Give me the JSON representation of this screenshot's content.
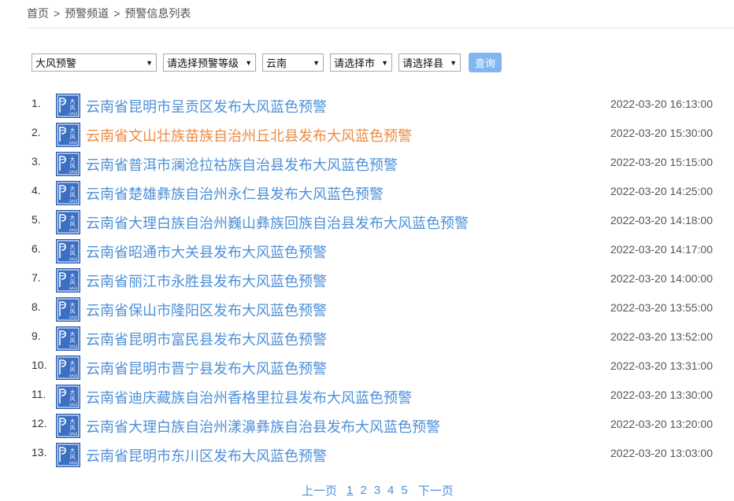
{
  "breadcrumb": {
    "home": "首页",
    "channel": "预警频道",
    "current": "预警信息列表",
    "separator": ">"
  },
  "filters": {
    "type": "大风预警",
    "level": "请选择预警等级",
    "province": "云南",
    "city": "请选择市",
    "county": "请选择县",
    "query_label": "查询"
  },
  "icon": {
    "name": "gale-blue-warning-icon",
    "text_top": "大风",
    "text_bottom": "GALE",
    "color": "#3a6fc4"
  },
  "alerts": [
    {
      "num": "1.",
      "title": "云南省昆明市呈贡区发布大风蓝色预警",
      "time": "2022-03-20 16:13:00"
    },
    {
      "num": "2.",
      "title": "云南省文山壮族苗族自治州丘北县发布大风蓝色预警",
      "time": "2022-03-20 15:30:00"
    },
    {
      "num": "3.",
      "title": "云南省普洱市澜沧拉祜族自治县发布大风蓝色预警",
      "time": "2022-03-20 15:15:00"
    },
    {
      "num": "4.",
      "title": "云南省楚雄彝族自治州永仁县发布大风蓝色预警",
      "time": "2022-03-20 14:25:00"
    },
    {
      "num": "5.",
      "title": "云南省大理白族自治州巍山彝族回族自治县发布大风蓝色预警",
      "time": "2022-03-20 14:18:00"
    },
    {
      "num": "6.",
      "title": "云南省昭通市大关县发布大风蓝色预警",
      "time": "2022-03-20 14:17:00"
    },
    {
      "num": "7.",
      "title": "云南省丽江市永胜县发布大风蓝色预警",
      "time": "2022-03-20 14:00:00"
    },
    {
      "num": "8.",
      "title": "云南省保山市隆阳区发布大风蓝色预警",
      "time": "2022-03-20 13:55:00"
    },
    {
      "num": "9.",
      "title": "云南省昆明市富民县发布大风蓝色预警",
      "time": "2022-03-20 13:52:00"
    },
    {
      "num": "10.",
      "title": "云南省昆明市晋宁县发布大风蓝色预警",
      "time": "2022-03-20 13:31:00"
    },
    {
      "num": "11.",
      "title": "云南省迪庆藏族自治州香格里拉县发布大风蓝色预警",
      "time": "2022-03-20 13:30:00"
    },
    {
      "num": "12.",
      "title": "云南省大理白族自治州漾濞彝族自治县发布大风蓝色预警",
      "time": "2022-03-20 13:20:00"
    },
    {
      "num": "13.",
      "title": "云南省昆明市东川区发布大风蓝色预警",
      "time": "2022-03-20 13:03:00"
    }
  ],
  "highlighted_index": 1,
  "colors": {
    "link": "#4d90d8",
    "visited_link": "#ee8a40",
    "button": "#83b6ef"
  },
  "pagination": {
    "prev": "上一页",
    "pages": [
      "1",
      "2",
      "3",
      "4",
      "5"
    ],
    "current": "1",
    "next": "下一页"
  }
}
